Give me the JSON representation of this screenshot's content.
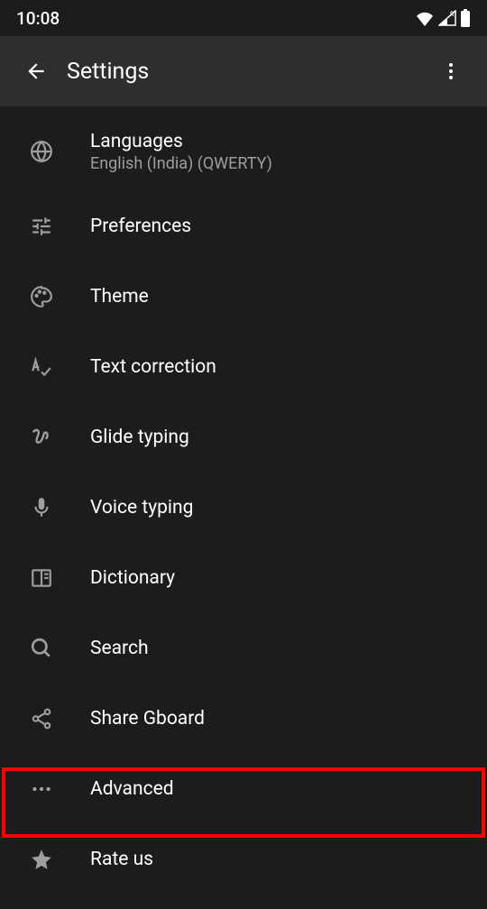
{
  "status": {
    "time": "10:08"
  },
  "appbar": {
    "title": "Settings"
  },
  "items": {
    "languages": {
      "title": "Languages",
      "subtitle": "English (India) (QWERTY)"
    },
    "preferences": {
      "title": "Preferences"
    },
    "theme": {
      "title": "Theme"
    },
    "textcorrection": {
      "title": "Text correction"
    },
    "glidetyping": {
      "title": "Glide typing"
    },
    "voicetyping": {
      "title": "Voice typing"
    },
    "dictionary": {
      "title": "Dictionary"
    },
    "search": {
      "title": "Search"
    },
    "sharegboard": {
      "title": "Share Gboard"
    },
    "advanced": {
      "title": "Advanced"
    },
    "rateus": {
      "title": "Rate us"
    }
  }
}
